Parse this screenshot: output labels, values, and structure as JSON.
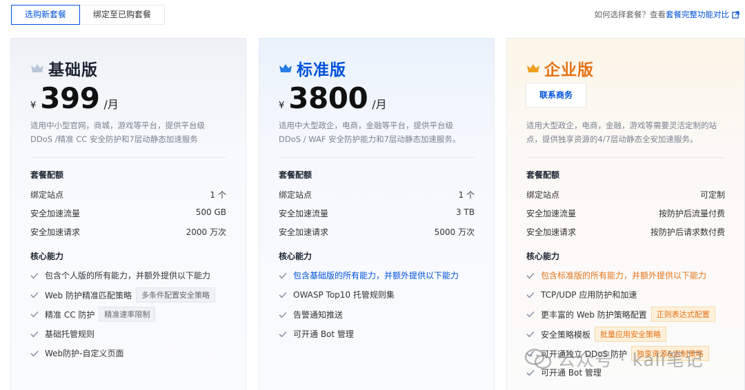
{
  "tabs": [
    {
      "label": "选购新套餐",
      "active": true
    },
    {
      "label": "绑定至已购套餐",
      "active": false
    }
  ],
  "help": {
    "prefix": "如何选择套餐？查看",
    "link": "套餐完整功能对比",
    "icon": "external-link-icon"
  },
  "plans": {
    "basic": {
      "name": "基础版",
      "currency": "¥",
      "price": "399",
      "unit": "/月",
      "desc": "适用中小型官网，商城，游戏等平台，提供平台级 DDoS /精准 CC 安全防护和7层动静态加速服务",
      "quota_title": "套餐配额",
      "quota": [
        {
          "label": "绑定站点",
          "value": "1 个"
        },
        {
          "label": "安全加速流量",
          "value": "500 GB"
        },
        {
          "label": "安全加速请求",
          "value": "2000 万次"
        }
      ],
      "feature_title": "核心能力",
      "features": [
        {
          "text": "包含个人版的所有能力，并额外提供以下能力",
          "tag": ""
        },
        {
          "text": "Web 防护精准匹配策略",
          "tag": "多条件配置安全策略"
        },
        {
          "text": "精准 CC 防护",
          "tag": "精准速率限制"
        },
        {
          "text": "基础托管规则",
          "tag": ""
        },
        {
          "text": "Web防护-自定义页面",
          "tag": ""
        }
      ]
    },
    "standard": {
      "name": "标准版",
      "currency": "¥",
      "price": "3800",
      "unit": "/月",
      "desc": "适用中大型政企，电商，金融等平台，提供平台级 DDoS / WAF 安全防护能力和7层动静态加速服务。",
      "quota_title": "套餐配额",
      "quota": [
        {
          "label": "绑定站点",
          "value": "1 个"
        },
        {
          "label": "安全加速流量",
          "value": "3 TB"
        },
        {
          "label": "安全加速请求",
          "value": "5000 万次"
        }
      ],
      "feature_title": "核心能力",
      "features": [
        {
          "text": "包含基础版的所有能力，并额外提供以下能力",
          "tag": ""
        },
        {
          "text": "OWASP Top10 托管规则集",
          "tag": ""
        },
        {
          "text": "告警通知推送",
          "tag": ""
        },
        {
          "text": "可开通 Bot 管理",
          "tag": ""
        }
      ]
    },
    "enterprise": {
      "name": "企业版",
      "contact": "联系商务",
      "desc": "适用大型政企，电商，金融，游戏等需要灵活定制的站点，提供独享资源的4/7层动静态全安加速服务。",
      "quota_title": "套餐配额",
      "quota": [
        {
          "label": "绑定站点",
          "value": "可定制"
        },
        {
          "label": "安全加速流量",
          "value": "按防护后流量付费"
        },
        {
          "label": "安全加速请求",
          "value": "按防护后请求数付费"
        }
      ],
      "feature_title": "核心能力",
      "features": [
        {
          "text": "包含标准版的所有能力，并额外提供以下能力",
          "tag": ""
        },
        {
          "text": "TCP/UDP 应用防护和加速",
          "tag": ""
        },
        {
          "text": "更丰富的 Web 防护策略配置",
          "tag": "正则表达式配置"
        },
        {
          "text": "安全策略模板",
          "tag": "批量应用安全策略"
        },
        {
          "text": "可开通独立 DDoS 防护",
          "tag": "独享资源&定制策略"
        },
        {
          "text": "可开通 Bot 管理",
          "tag": ""
        }
      ]
    }
  },
  "watermark": "公众号 · kali笔记",
  "colors": {
    "primary": "#0052d9",
    "enterprise": "#e37318"
  }
}
